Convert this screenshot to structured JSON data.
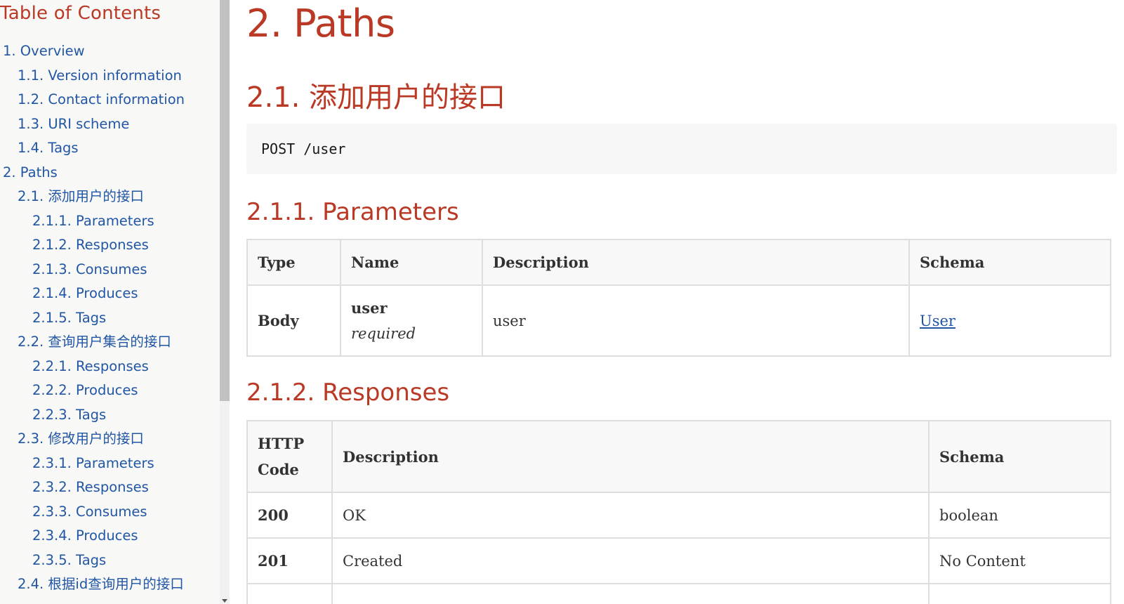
{
  "toc": {
    "title": "Table of Contents",
    "items": [
      {
        "label": "1. Overview",
        "level": 1
      },
      {
        "label": "1.1. Version information",
        "level": 2
      },
      {
        "label": "1.2. Contact information",
        "level": 2
      },
      {
        "label": "1.3. URI scheme",
        "level": 2
      },
      {
        "label": "1.4. Tags",
        "level": 2
      },
      {
        "label": "2. Paths",
        "level": 1
      },
      {
        "label": "2.1. 添加用户的接口",
        "level": 2
      },
      {
        "label": "2.1.1. Parameters",
        "level": 3
      },
      {
        "label": "2.1.2. Responses",
        "level": 3
      },
      {
        "label": "2.1.3. Consumes",
        "level": 3
      },
      {
        "label": "2.1.4. Produces",
        "level": 3
      },
      {
        "label": "2.1.5. Tags",
        "level": 3
      },
      {
        "label": "2.2. 查询用户集合的接口",
        "level": 2
      },
      {
        "label": "2.2.1. Responses",
        "level": 3
      },
      {
        "label": "2.2.2. Produces",
        "level": 3
      },
      {
        "label": "2.2.3. Tags",
        "level": 3
      },
      {
        "label": "2.3. 修改用户的接口",
        "level": 2
      },
      {
        "label": "2.3.1. Parameters",
        "level": 3
      },
      {
        "label": "2.3.2. Responses",
        "level": 3
      },
      {
        "label": "2.3.3. Consumes",
        "level": 3
      },
      {
        "label": "2.3.4. Produces",
        "level": 3
      },
      {
        "label": "2.3.5. Tags",
        "level": 3
      },
      {
        "label": "2.4. 根据id查询用户的接口",
        "level": 2
      }
    ]
  },
  "content": {
    "section_title": "2. Paths",
    "endpoint_title": "2.1. 添加用户的接口",
    "endpoint": "POST /user",
    "parameters": {
      "title": "2.1.1. Parameters",
      "headers": [
        "Type",
        "Name",
        "Description",
        "Schema"
      ],
      "rows": [
        {
          "type": "Body",
          "name": "user",
          "required": "required",
          "description": "user",
          "schema": "User"
        }
      ]
    },
    "responses": {
      "title": "2.1.2. Responses",
      "headers": [
        "HTTP Code",
        "Description",
        "Schema"
      ],
      "rows": [
        {
          "code": "200",
          "description": "OK",
          "schema": "boolean"
        },
        {
          "code": "201",
          "description": "Created",
          "schema": "No Content"
        }
      ]
    }
  },
  "colors": {
    "heading": "#ba3925",
    "link": "#2156a5",
    "sidebar_bg": "#f8f8f7",
    "code_bg": "#f7f7f8",
    "table_header_bg": "#f7f8f7",
    "table_border": "#dedede"
  }
}
